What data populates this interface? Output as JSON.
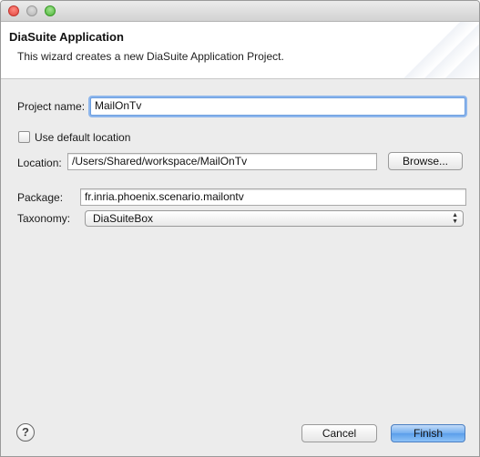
{
  "window": {
    "controls": {
      "close_icon": "close-icon",
      "minimize_icon": "minimize-icon",
      "zoom_icon": "zoom-icon"
    }
  },
  "header": {
    "title": "DiaSuite Application",
    "description": "This wizard creates a new DiaSuite Application Project."
  },
  "form": {
    "project_name": {
      "label": "Project name:",
      "value": "MailOnTv"
    },
    "use_default_location": {
      "label": "Use default location",
      "checked": false
    },
    "location": {
      "label": "Location:",
      "value": "/Users/Shared/workspace/MailOnTv",
      "browse_label": "Browse..."
    },
    "package": {
      "label": "Package:",
      "value": "fr.inria.phoenix.scenario.mailontv"
    },
    "taxonomy": {
      "label": "Taxonomy:",
      "selected": "DiaSuiteBox"
    }
  },
  "footer": {
    "help_icon": "help-icon",
    "help_glyph": "?",
    "cancel_label": "Cancel",
    "finish_label": "Finish"
  },
  "colors": {
    "accent": "#5b9eea",
    "focus_ring": "#8db6ec",
    "window_bg": "#ececec"
  }
}
